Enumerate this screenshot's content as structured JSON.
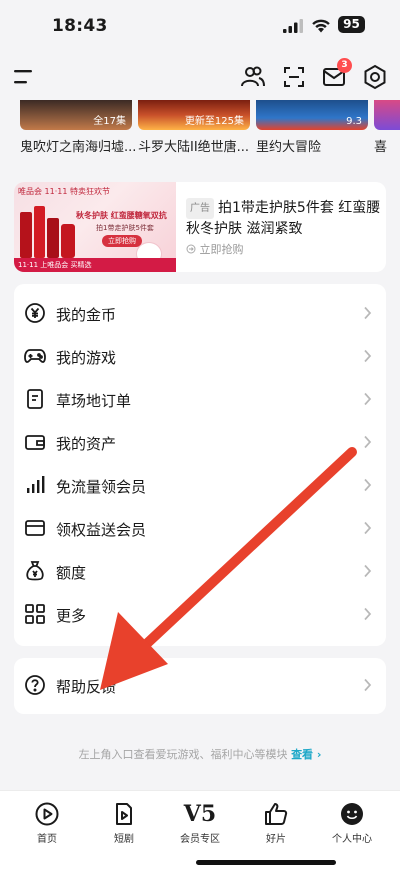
{
  "status_bar": {
    "time": "18:43",
    "battery": "95"
  },
  "top_nav": {
    "mail_badge": "3"
  },
  "videos": [
    {
      "title": "鬼吹灯之南海归墟...",
      "label": "全17集"
    },
    {
      "title": "斗罗大陆II绝世唐...",
      "label": "更新至125集"
    },
    {
      "title": "里约大冒险",
      "label": "9.3"
    },
    {
      "title": "喜",
      "label": ""
    }
  ],
  "ad": {
    "tag": "广告",
    "text": "拍1带走护肤5件套 红蛮腰秋冬护肤 滋润紧致",
    "cta": "立即抢购",
    "banner_top": "唯品会 11·11 特卖狂欢节",
    "banner_headline": "秋冬护肤 红蛮腰糖氧双抗",
    "banner_sub": "拍1带走护肤5件套",
    "banner_button": "立即抢购",
    "banner_footer": "11·11 上唯品会 买精选"
  },
  "menu": {
    "items": [
      {
        "label": "我的金币",
        "icon": "coin-icon"
      },
      {
        "label": "我的游戏",
        "icon": "gamepad-icon"
      },
      {
        "label": "草场地订单",
        "icon": "order-icon"
      },
      {
        "label": "我的资产",
        "icon": "wallet-icon"
      },
      {
        "label": "免流量领会员",
        "icon": "signal-bars-icon"
      },
      {
        "label": "领权益送会员",
        "icon": "card-icon"
      },
      {
        "label": "额度",
        "icon": "money-bag-icon"
      },
      {
        "label": "更多",
        "icon": "grid-icon"
      }
    ],
    "help": {
      "label": "帮助反馈",
      "icon": "help-icon"
    }
  },
  "hint": {
    "text": "左上角入口查看爱玩游戏、福利中心等模块",
    "link": "查看"
  },
  "tab_bar": {
    "tabs": [
      {
        "label": "首页",
        "icon": "play-icon"
      },
      {
        "label": "短剧",
        "icon": "short-drama-icon"
      },
      {
        "label": "会员专区",
        "icon": "v5-icon",
        "mark": "V5"
      },
      {
        "label": "好片",
        "icon": "thumbs-up-icon"
      },
      {
        "label": "个人中心",
        "icon": "profile-icon"
      }
    ]
  },
  "colors": {
    "accent": "#1ea8c8",
    "badge": "#ff4d4f",
    "arrow": "#e8412c"
  }
}
